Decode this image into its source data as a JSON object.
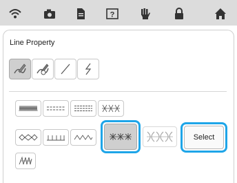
{
  "status_bar": {
    "icons": [
      "wifi-icon",
      "camera-icon",
      "document-icon",
      "help-icon",
      "hand-icon",
      "lock-icon",
      "home-icon"
    ]
  },
  "panel": {
    "title": "Line Property",
    "line_tools": [
      "pen-stroke-icon",
      "eraser-pen-icon",
      "straight-line-icon",
      "zigzag-line-icon"
    ],
    "stitch_patterns": [
      "zigzag-satin-stitch",
      "dashed-line-stitch",
      "double-dashed-stitch",
      "triple-cross-stitch",
      "chain-stitch",
      "blanket-stitch",
      "wave-stitch",
      "motif-stitch-selected",
      "motif-stitch-dimmed",
      "candlewick-stitch"
    ],
    "select_label": "Select",
    "highlight_color": "#1ea5e8"
  }
}
